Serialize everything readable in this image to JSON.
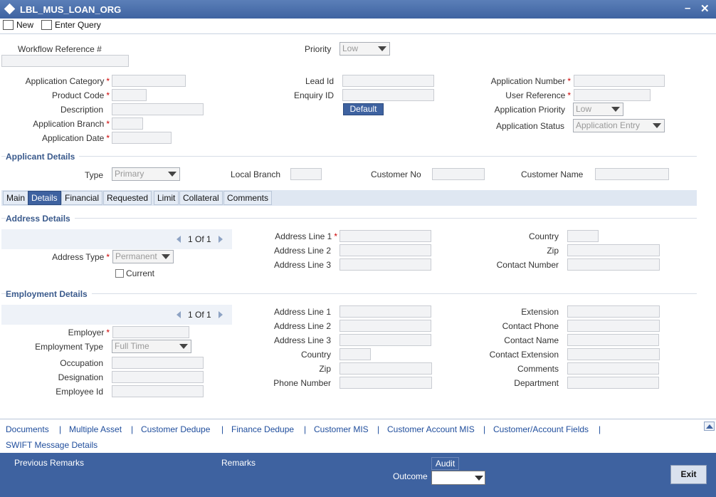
{
  "window": {
    "title": "LBL_MUS_LOAN_ORG",
    "minimize": "–",
    "close": "✕"
  },
  "toolbar": {
    "new_label": "New",
    "enter_query_label": "Enter Query"
  },
  "header": {
    "workflow_ref_label": "Workflow Reference #",
    "priority_label": "Priority",
    "priority_value": "Low",
    "app_category_label": "Application Category",
    "product_code_label": "Product Code",
    "description_label": "Description",
    "app_branch_label": "Application Branch",
    "app_date_label": "Application Date",
    "lead_id_label": "Lead Id",
    "enquiry_id_label": "Enquiry ID",
    "default_label": "Default",
    "app_number_label": "Application Number",
    "user_ref_label": "User Reference",
    "app_priority_label": "Application Priority",
    "app_priority_value": "Low",
    "app_status_label": "Application Status",
    "app_status_value": "Application Entry",
    "required_mark": "*"
  },
  "applicant": {
    "section_title": "Applicant Details",
    "type_label": "Type",
    "type_value": "Primary",
    "local_branch_label": "Local Branch",
    "customer_no_label": "Customer No",
    "customer_name_label": "Customer Name"
  },
  "tabs": [
    {
      "label": "Main"
    },
    {
      "label": "Details"
    },
    {
      "label": "Financial"
    },
    {
      "label": "Requested"
    },
    {
      "label": "Limit"
    },
    {
      "label": "Collateral"
    },
    {
      "label": "Comments"
    }
  ],
  "address": {
    "section_title": "Address Details",
    "pager": "1 Of 1",
    "address_type_label": "Address Type",
    "address_type_value": "Permanent",
    "current_label": "Current",
    "line1_label": "Address Line 1",
    "line2_label": "Address Line 2",
    "line3_label": "Address Line 3",
    "country_label": "Country",
    "zip_label": "Zip",
    "contact_number_label": "Contact Number"
  },
  "employment": {
    "section_title": "Employment Details",
    "pager": "1 Of 1",
    "employer_label": "Employer",
    "employment_type_label": "Employment Type",
    "employment_type_value": "Full Time",
    "occupation_label": "Occupation",
    "designation_label": "Designation",
    "employee_id_label": "Employee Id",
    "line1_label": "Address Line 1",
    "line2_label": "Address Line 2",
    "line3_label": "Address Line 3",
    "country_label": "Country",
    "zip_label": "Zip",
    "phone_label": "Phone Number",
    "extension_label": "Extension",
    "contact_phone_label": "Contact Phone",
    "contact_name_label": "Contact Name",
    "contact_extension_label": "Contact Extension",
    "comments_label": "Comments",
    "department_label": "Department"
  },
  "links": {
    "items": [
      "Documents",
      "Multiple Asset",
      "Customer Dedupe",
      "Finance Dedupe",
      "Customer MIS",
      "Customer Account MIS",
      "Customer/Account Fields"
    ],
    "separator": "|",
    "swift": "SWIFT Message Details"
  },
  "footer": {
    "previous_remarks_label": "Previous Remarks",
    "remarks_label": "Remarks",
    "audit_label": "Audit",
    "outcome_label": "Outcome",
    "exit_label": "Exit"
  },
  "colors": {
    "accent": "#3e62a0",
    "link": "#1f4d9c",
    "required": "#cc0000"
  }
}
